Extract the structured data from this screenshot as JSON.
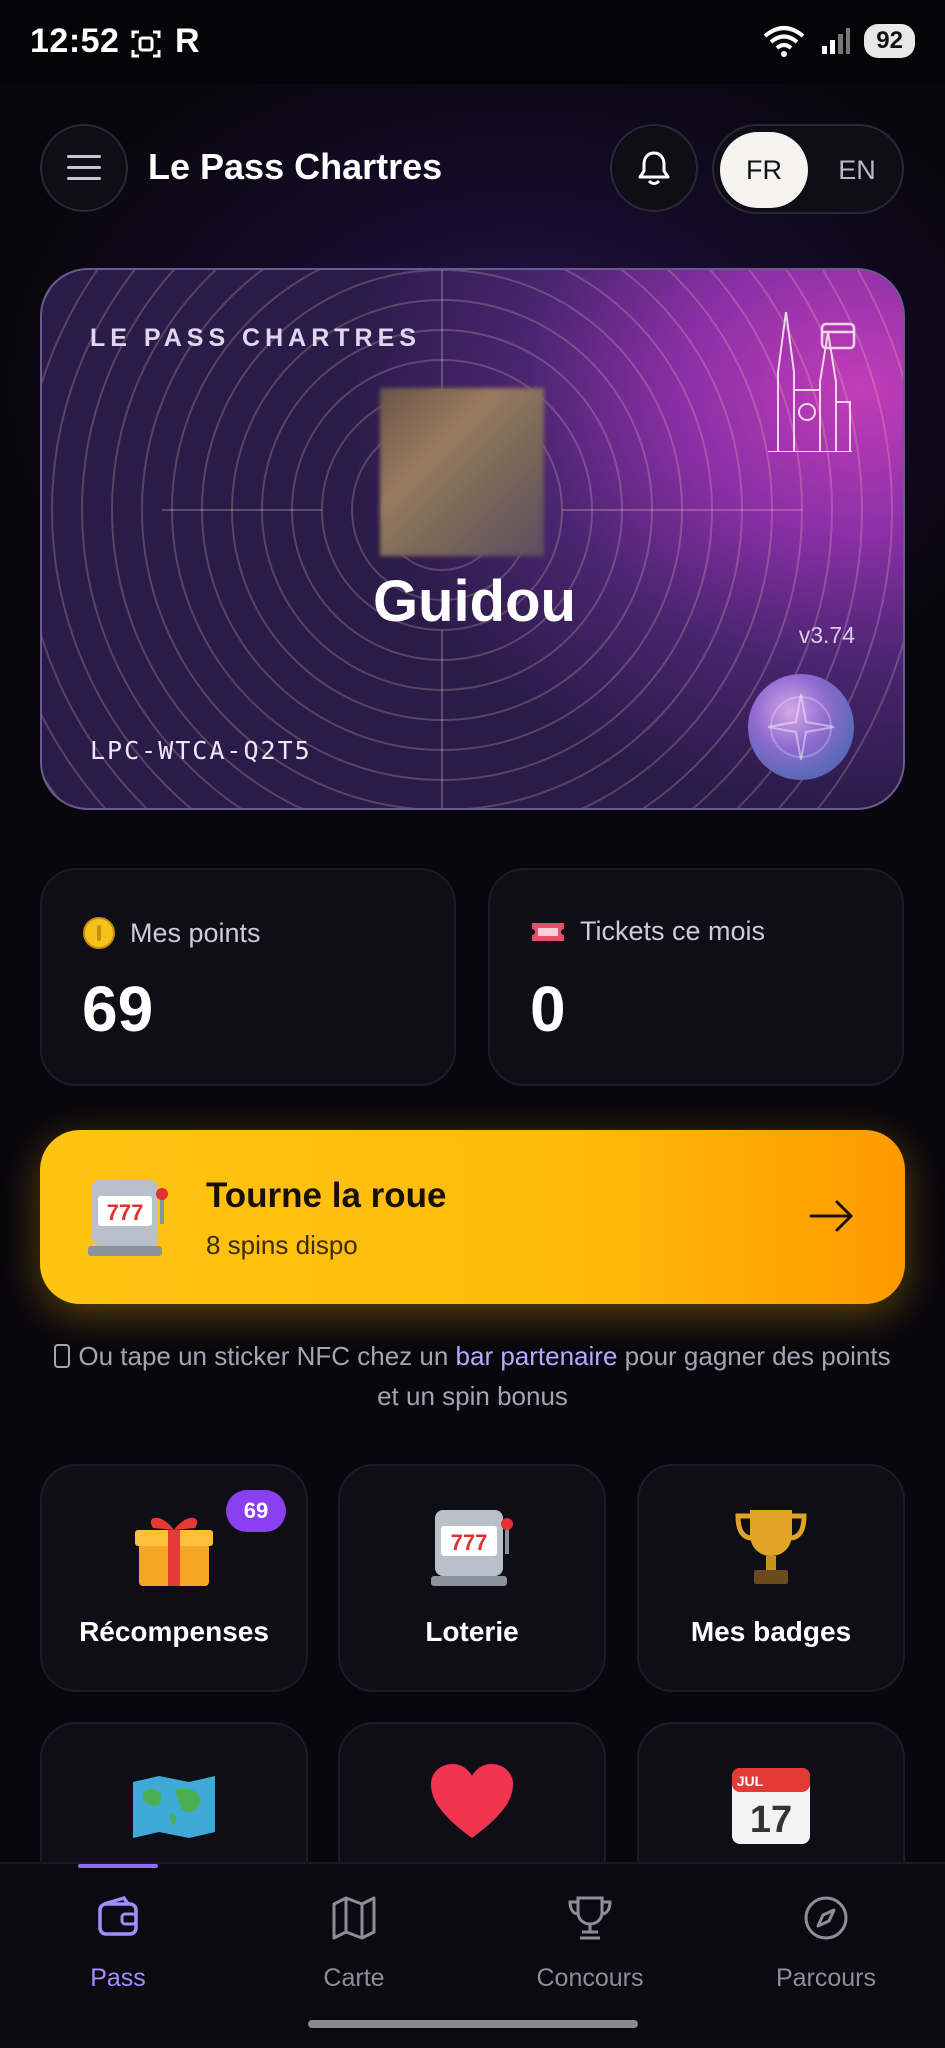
{
  "status_bar": {
    "time": "12:52",
    "r_icon": "R",
    "battery": "92"
  },
  "header": {
    "title": "Le Pass Chartres",
    "lang_fr": "FR",
    "lang_en": "EN"
  },
  "pass_card": {
    "brand": "LE PASS CHARTRES",
    "name": "Guidou",
    "version": "v3.74",
    "code": "LPC-WTCA-Q2T5",
    "accent": "#a83cc2"
  },
  "stats": {
    "points_label": "Mes points",
    "points_value": "69",
    "tickets_label": "Tickets ce mois",
    "tickets_value": "0"
  },
  "spin": {
    "title": "Tourne la roue",
    "subtitle": "8 spins dispo",
    "color": "#ffc412"
  },
  "nfc_hint": {
    "before": "Ou tape un sticker NFC chez un ",
    "link": "bar partenaire",
    "after": " pour gagner des points et un spin bonus"
  },
  "tiles": [
    {
      "label": "Récompenses",
      "badge": "69",
      "icon": "gift-icon"
    },
    {
      "label": "Loterie",
      "icon": "slot-machine-icon"
    },
    {
      "label": "Mes badges",
      "icon": "trophy-icon"
    },
    {
      "label": "",
      "icon": "world-map-icon"
    },
    {
      "label": "",
      "icon": "heart-icon"
    },
    {
      "label": "",
      "icon": "calendar-icon"
    }
  ],
  "calendar": {
    "month": "JUL",
    "day": "17"
  },
  "nav": [
    {
      "label": "Pass",
      "icon": "wallet-icon",
      "active": true
    },
    {
      "label": "Carte",
      "icon": "map-icon"
    },
    {
      "label": "Concours",
      "icon": "trophy-icon"
    },
    {
      "label": "Parcours",
      "icon": "compass-icon"
    }
  ]
}
